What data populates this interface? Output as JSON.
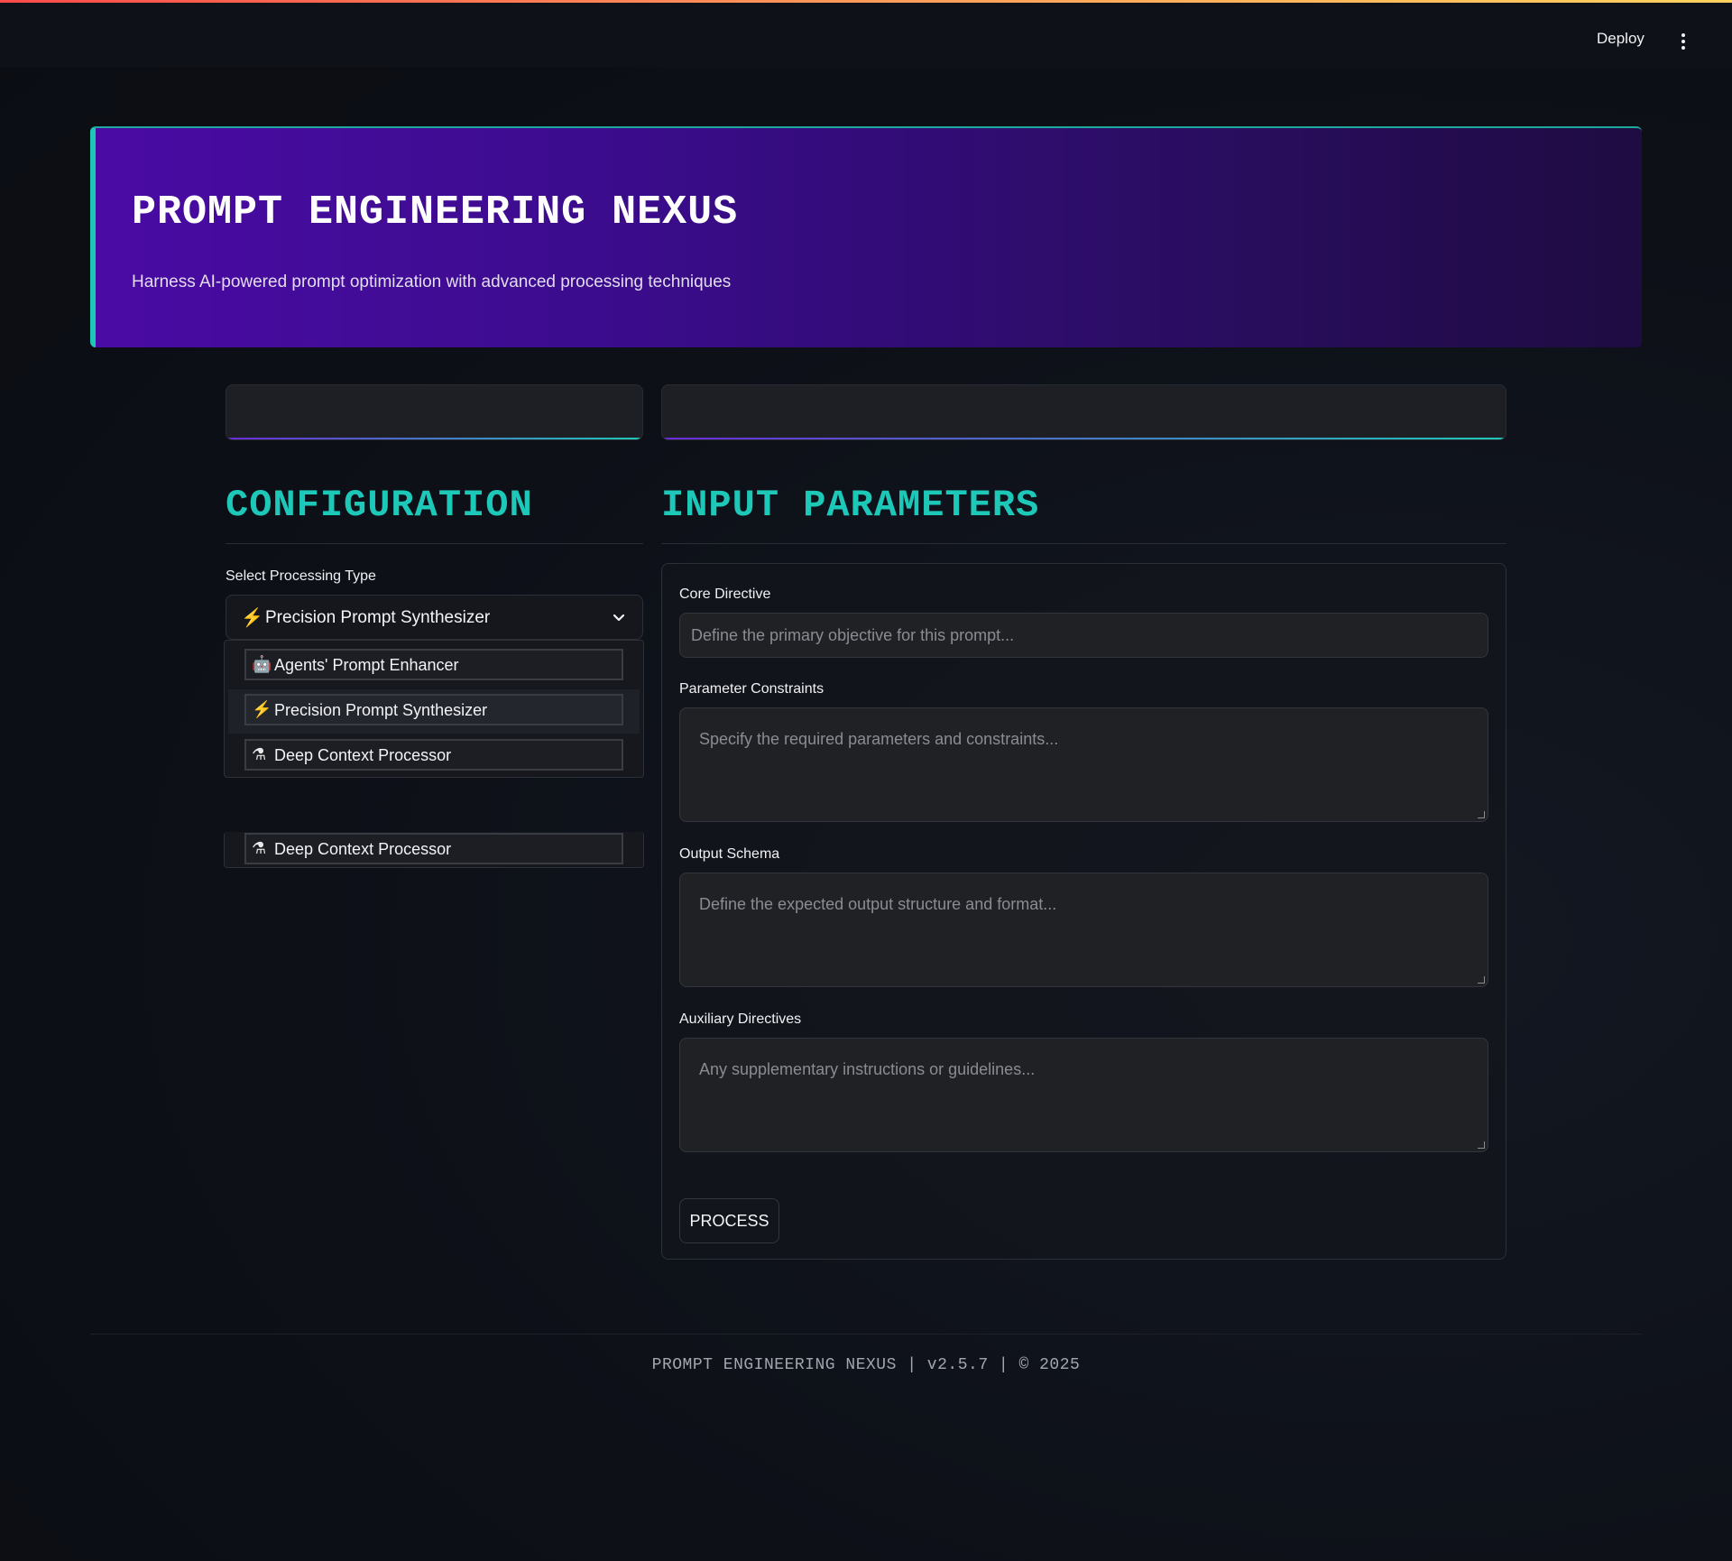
{
  "app": {
    "deploy_label": "Deploy",
    "menu_icon": "kebab-menu-icon",
    "accent_color": "#1ec8b8",
    "brand_gradient": [
      "#4a0ba4",
      "#1f0c42"
    ]
  },
  "hero": {
    "title": "PROMPT ENGINEERING NEXUS",
    "subtitle": "Harness AI-powered prompt optimization with advanced processing techniques"
  },
  "configuration": {
    "heading": "CONFIGURATION",
    "select_label": "Select Processing Type",
    "selected": {
      "icon": "lightning-icon",
      "glyph": "⚡",
      "label": "Precision Prompt Synthesizer"
    },
    "options": [
      {
        "icon": "robot-icon",
        "glyph": "🤖",
        "label": "Agents' Prompt Enhancer"
      },
      {
        "icon": "lightning-icon",
        "glyph": "⚡",
        "label": "Precision Prompt Synthesizer"
      },
      {
        "icon": "flask-icon",
        "glyph": "⚗",
        "label": "Deep Context Processor"
      }
    ],
    "ghost_option": {
      "icon": "flask-icon",
      "glyph": "⚗",
      "label": "Deep Context Processor"
    }
  },
  "input_parameters": {
    "heading": "INPUT PARAMETERS",
    "core_directive": {
      "label": "Core Directive",
      "value": "",
      "placeholder": "Define the primary objective for this prompt..."
    },
    "parameter_constraints": {
      "label": "Parameter Constraints",
      "value": "",
      "placeholder": "Specify the required parameters and constraints..."
    },
    "output_schema": {
      "label": "Output Schema",
      "value": "",
      "placeholder": "Define the expected output structure and format..."
    },
    "auxiliary_directives": {
      "label": "Auxiliary Directives",
      "value": "",
      "placeholder": "Any supplementary instructions or guidelines..."
    },
    "process_button": "PROCESS"
  },
  "footer": {
    "text": "PROMPT ENGINEERING NEXUS | v2.5.7 | © 2025"
  }
}
